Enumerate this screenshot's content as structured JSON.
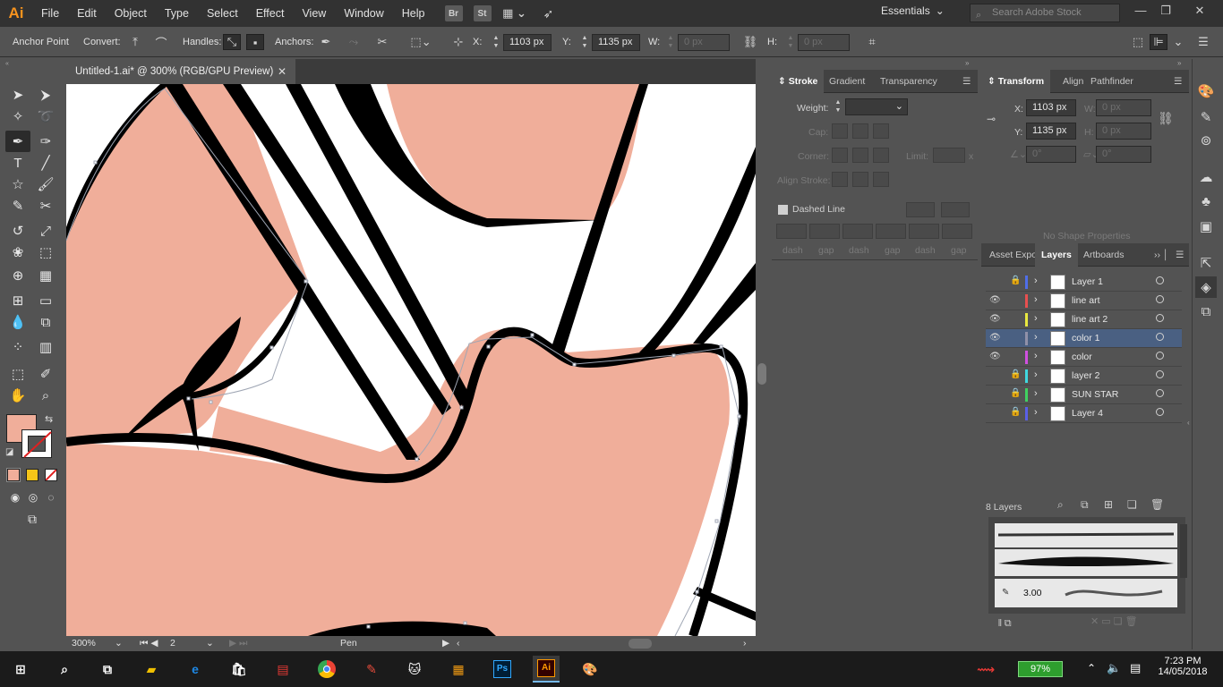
{
  "app": {
    "logo": "Ai",
    "menu": [
      "File",
      "Edit",
      "Object",
      "Type",
      "Select",
      "Effect",
      "View",
      "Window",
      "Help"
    ],
    "bridge": "Br",
    "stock": "St",
    "workspace": "Essentials",
    "search_placeholder": "Search Adobe Stock"
  },
  "control": {
    "mode_label": "Anchor Point",
    "convert_label": "Convert:",
    "handles_label": "Handles:",
    "anchors_label": "Anchors:",
    "x_label": "X:",
    "x_value": "1103 px",
    "y_label": "Y:",
    "y_value": "1135 px",
    "w_label": "W:",
    "w_value": "0 px",
    "h_label": "H:",
    "h_value": "0 px"
  },
  "document": {
    "tab_title": "Untitled-1.ai* @ 300% (RGB/GPU Preview)",
    "close": "✕",
    "zoom": "300%",
    "artboard": "2",
    "tool_status": "Pen"
  },
  "stroke_panel": {
    "tabs": [
      "Stroke",
      "Gradient",
      "Transparency"
    ],
    "weight_label": "Weight:",
    "cap_label": "Cap:",
    "corner_label": "Corner:",
    "limit_label": "Limit:",
    "limit_unit": "x",
    "align_label": "Align Stroke:",
    "dashed_label": "Dashed Line",
    "dash_labels": [
      "dash",
      "gap",
      "dash",
      "gap",
      "dash",
      "gap"
    ]
  },
  "transform_panel": {
    "tabs": [
      "Transform",
      "Align",
      "Pathfinder"
    ],
    "x_label": "X:",
    "x_value": "1103 px",
    "y_label": "Y:",
    "y_value": "1135 px",
    "w_label": "W:",
    "w_value": "0 px",
    "h_label": "H:",
    "h_value": "0 px",
    "angle_value": "0°",
    "shear_value": "0°",
    "no_shape": "No Shape Properties"
  },
  "layers_panel": {
    "tabs": [
      "Asset Expo",
      "Layers",
      "Artboards"
    ],
    "count": "8 Layers",
    "layers": [
      {
        "name": "Layer 1",
        "visible": false,
        "locked": true,
        "color": "#4f6ee8",
        "selected": false
      },
      {
        "name": "line art",
        "visible": true,
        "locked": false,
        "color": "#e85050",
        "selected": false
      },
      {
        "name": "line art 2",
        "visible": true,
        "locked": false,
        "color": "#e8e840",
        "selected": false
      },
      {
        "name": "color 1",
        "visible": true,
        "locked": false,
        "color": "#9090a8",
        "selected": true
      },
      {
        "name": "color",
        "visible": true,
        "locked": false,
        "color": "#d050e0",
        "selected": false
      },
      {
        "name": "layer 2",
        "visible": false,
        "locked": true,
        "color": "#40d8e0",
        "selected": false
      },
      {
        "name": "SUN STAR",
        "visible": false,
        "locked": true,
        "color": "#40d060",
        "selected": false
      },
      {
        "name": "Layer 4",
        "visible": false,
        "locked": true,
        "color": "#5a60e8",
        "selected": false
      }
    ]
  },
  "brushes_panel": {
    "brush_size": "3.00"
  },
  "colors": {
    "fill": "#f0ae9a",
    "accent": "#f7931e"
  },
  "taskbar": {
    "battery": "97%",
    "time": "7:23 PM",
    "date": "14/05/2018",
    "ps_label": "Ps",
    "ai_label": "Ai"
  }
}
